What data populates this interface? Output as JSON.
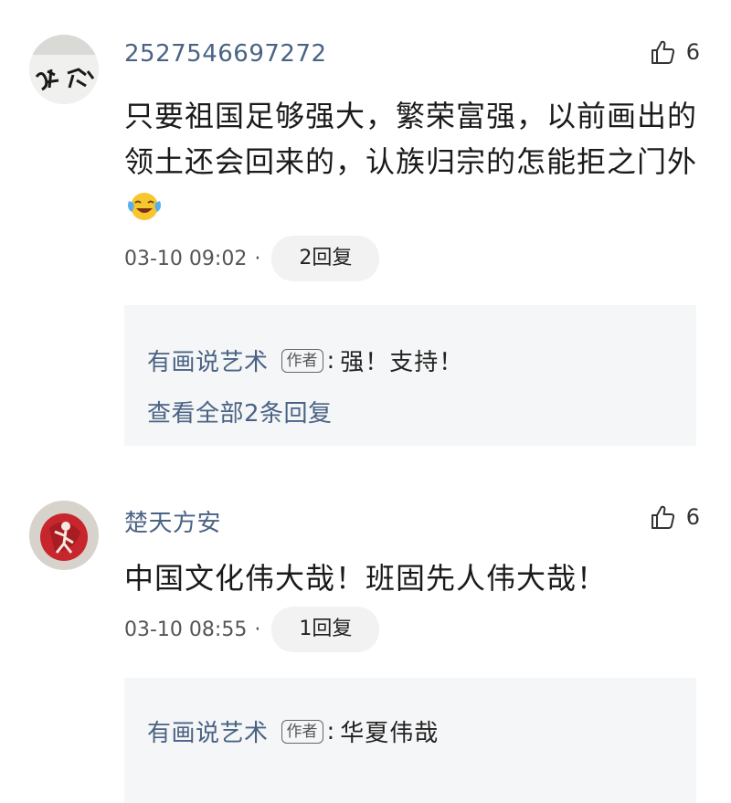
{
  "comments": [
    {
      "username": "2527546697272",
      "likes": "6",
      "text": "只要祖国足够强大，繁荣富强，以前画出的领土还会回来的，认族归宗的怎能拒之门外",
      "emoji": "laughing-tears-emoji",
      "time": "03-10 09:02",
      "dot": "·",
      "reply_count": "2回复",
      "reply": {
        "author": "有画说艺术",
        "tag": "作者",
        "colon": ":",
        "text": "强！支持！"
      },
      "view_all": "查看全部2条回复"
    },
    {
      "username": "楚天方安",
      "likes": "6",
      "text": "中国文化伟大哉！班固先人伟大哉！",
      "time": "03-10 08:55",
      "dot": "·",
      "reply_count": "1回复",
      "reply": {
        "author": "有画说艺术",
        "tag": "作者",
        "colon": ":",
        "text": "华夏伟哉"
      }
    }
  ],
  "icons": {
    "like": "thumbs-up-icon"
  },
  "colors": {
    "username": "#4a6384",
    "reply_box": "#f5f6f7",
    "pill": "#f2f2f2"
  }
}
